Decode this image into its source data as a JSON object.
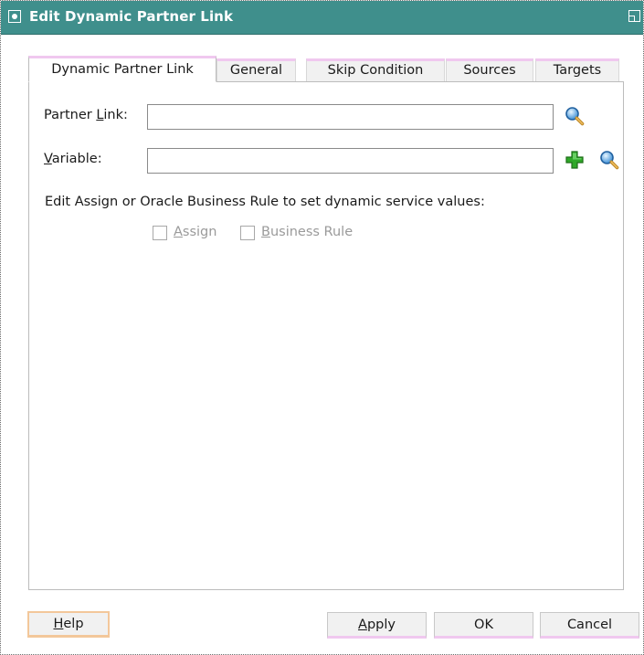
{
  "window": {
    "title": "Edit Dynamic Partner Link"
  },
  "tabs": [
    {
      "label": "Dynamic Partner Link",
      "active": true
    },
    {
      "label": "General",
      "active": false
    },
    {
      "label": "Skip Condition",
      "active": false
    },
    {
      "label": "Sources",
      "active": false
    },
    {
      "label": "Targets",
      "active": false
    }
  ],
  "form": {
    "partner_link": {
      "label_pre": "Partner ",
      "label_mnemonic": "L",
      "label_post": "ink:",
      "value": ""
    },
    "variable": {
      "label_pre": "",
      "label_mnemonic": "V",
      "label_post": "ariable:",
      "value": ""
    }
  },
  "hint": "Edit Assign or Oracle Business Rule to set dynamic service values:",
  "checkboxes": {
    "assign": {
      "mnemonic": "A",
      "rest": "ssign",
      "checked": false,
      "enabled": false
    },
    "business_rule": {
      "mnemonic": "B",
      "rest": "usiness Rule",
      "checked": false,
      "enabled": false
    }
  },
  "buttons": {
    "help": {
      "mnemonic": "H",
      "rest": "elp"
    },
    "apply": {
      "mnemonic": "A",
      "rest": "pply"
    },
    "ok": "OK",
    "cancel": "Cancel"
  },
  "icons": {
    "title": "window-menu-icon",
    "maximize": "maximize-icon",
    "search": "magnifier-icon",
    "add": "green-plus-icon"
  }
}
